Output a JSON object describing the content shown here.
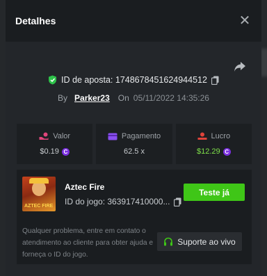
{
  "modal": {
    "title": "Detalhes"
  },
  "bet": {
    "id_label": "ID de aposta: 1748678451624944512",
    "by_label": "By",
    "username": "Parker23",
    "on_label": "On",
    "date": "05/11/2022 14:35:26"
  },
  "stats": [
    {
      "label": "Valor",
      "value": "$0.19",
      "icon": "money-hand-icon",
      "color": "#e0457b",
      "currency": "coin-icon"
    },
    {
      "label": "Pagamento",
      "value": "62.5 x",
      "icon": "card-icon",
      "color": "#8a4ff0"
    },
    {
      "label": "Lucro",
      "value": "$12.29",
      "icon": "profit-icon",
      "color": "#e0433a",
      "value_color": "#7fe04a",
      "currency": "coin-icon"
    }
  ],
  "game": {
    "name": "Aztec Fire",
    "id_label": "ID do jogo: 363917410000...",
    "thumb_text": "AZTEC FIRE",
    "try_label": "Teste já"
  },
  "help": {
    "text": "Qualquer problema, entre em contato o atendimento ao cliente para obter ajuda e forneça o ID do jogo.",
    "support_label": "Suporte ao vivo"
  },
  "colors": {
    "accent_green": "#3fc617",
    "coin": "#7b2fe0",
    "verified": "#2ec24a"
  }
}
